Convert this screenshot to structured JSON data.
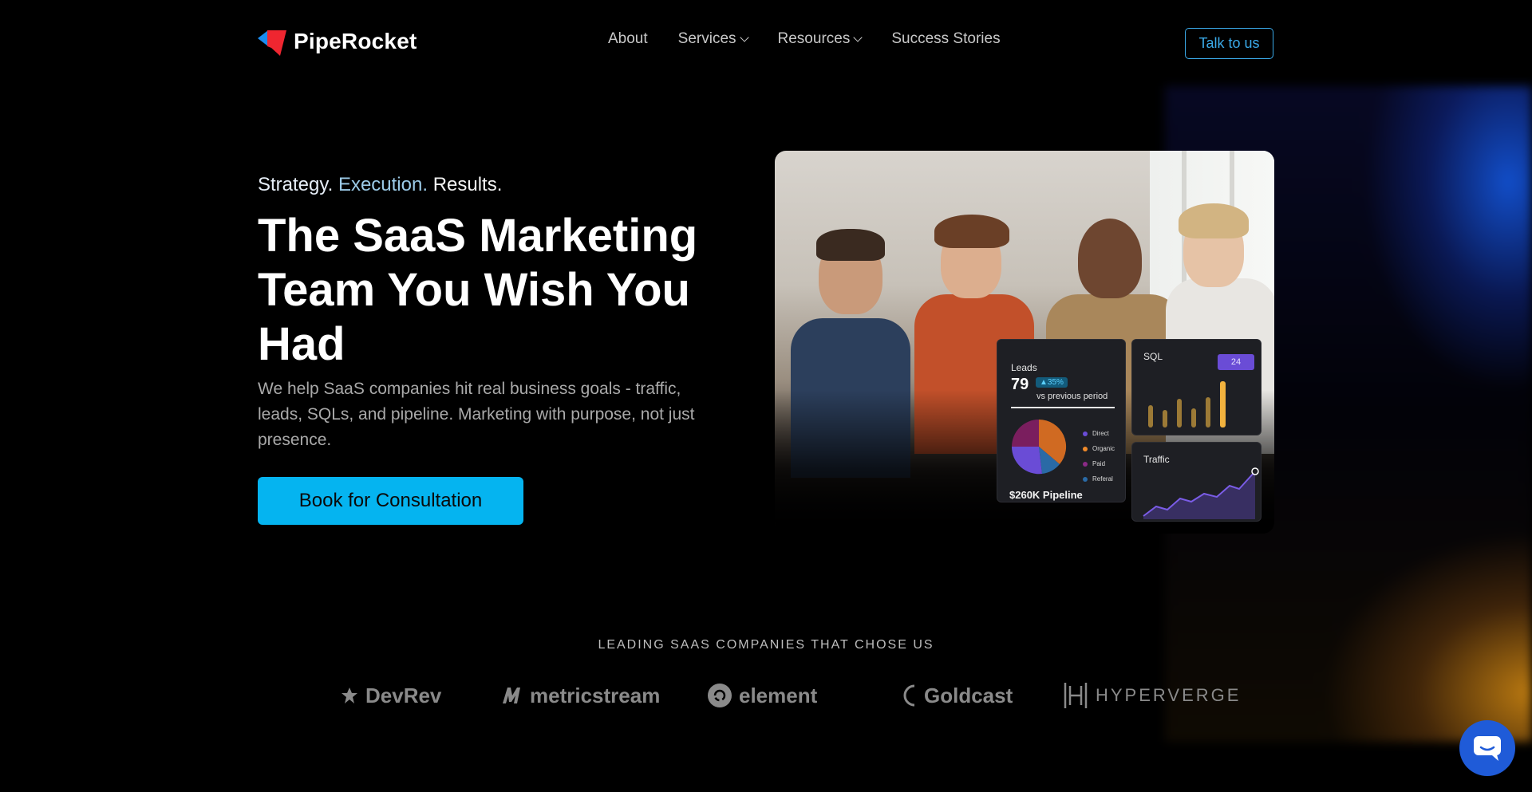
{
  "header": {
    "brand": "PipeRocket",
    "nav": [
      {
        "label": "About",
        "has_dropdown": false
      },
      {
        "label": "Services",
        "has_dropdown": true
      },
      {
        "label": "Resources",
        "has_dropdown": true
      },
      {
        "label": "Success Stories",
        "has_dropdown": false
      }
    ],
    "talk_label": "Talk to us"
  },
  "hero": {
    "tagline": [
      "Strategy.",
      "Execution.",
      "Results."
    ],
    "headline": "The SaaS Marketing Team You Wish You Had",
    "subtext": "We help SaaS companies hit real business goals - traffic, leads, SQLs, and pipeline. Marketing with purpose, not just presence.",
    "cta_label": "Book for Consultation"
  },
  "dashboard": {
    "leads": {
      "label": "Leads",
      "value": "79",
      "change": "▲35%",
      "compare": "vs previous period",
      "pipeline": "$260K Pipeline"
    },
    "legend": [
      {
        "name": "Direct",
        "color": "#6a4cd6"
      },
      {
        "name": "Organic",
        "color": "#f08a2a"
      },
      {
        "name": "Paid",
        "color": "#8a2a86"
      },
      {
        "name": "Referal",
        "color": "#2a6aa6"
      }
    ],
    "sql": {
      "label": "SQL",
      "badge": "24"
    },
    "traffic": {
      "label": "Traffic"
    },
    "accent_color": "#6a4cd6",
    "bar_color": "#e8a93a"
  },
  "clients": {
    "title": "LEADING SAAS COMPANIES THAT CHOSE US",
    "logos": [
      "DevRev",
      "metricstream",
      "element",
      "Goldcast",
      "HYPERVERGE"
    ]
  },
  "colors": {
    "cta": "#05b4f0",
    "talk_border": "#3aa9e8",
    "chat": "#1f5bd8"
  },
  "icons": {
    "brand": "piperocket-logo-icon",
    "chat": "chat-bubble-icon"
  }
}
